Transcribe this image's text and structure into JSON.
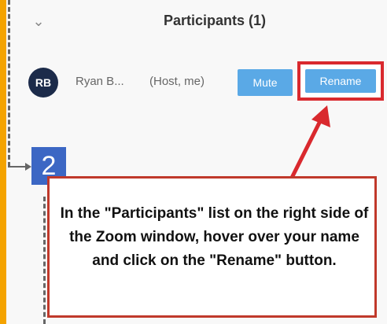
{
  "header": {
    "title": "Participants (1)",
    "chevron_icon": "chevron-down-icon"
  },
  "participant": {
    "initials": "RB",
    "name": "Ryan B...",
    "role": "(Host, me)",
    "mute_label": "Mute",
    "rename_label": "Rename"
  },
  "step": {
    "number": "2",
    "instruction": "In the \"Participants\" list on the right side of the Zoom window, hover over your name and click on the \"Rename\" button."
  },
  "colors": {
    "accent": "#5aa9e6",
    "highlight": "#d9292e",
    "badge": "#3c67c4",
    "avatar": "#1c2b4a",
    "edge": "#f4a300"
  }
}
